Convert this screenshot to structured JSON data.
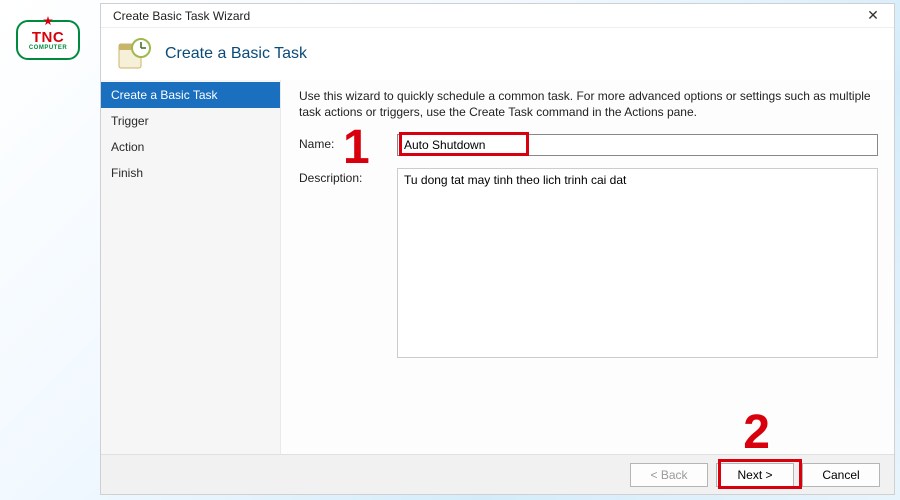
{
  "logo": {
    "brand": "TNC",
    "sub": "COMPUTER"
  },
  "window": {
    "title": "Create Basic Task Wizard",
    "page_title": "Create a Basic Task",
    "instructions": "Use this wizard to quickly schedule a common task.  For more advanced options or settings such as multiple task actions or triggers, use the Create Task command in the Actions pane."
  },
  "steps": {
    "s0": "Create a Basic Task",
    "s1": "Trigger",
    "s2": "Action",
    "s3": "Finish"
  },
  "form": {
    "name_label": "Name:",
    "name_value": "Auto Shutdown",
    "desc_label": "Description:",
    "desc_value": "Tu dong tat may tinh theo lich trinh cai dat"
  },
  "buttons": {
    "back": "< Back",
    "next": "Next >",
    "cancel": "Cancel"
  },
  "annotations": {
    "one": "1",
    "two": "2"
  }
}
